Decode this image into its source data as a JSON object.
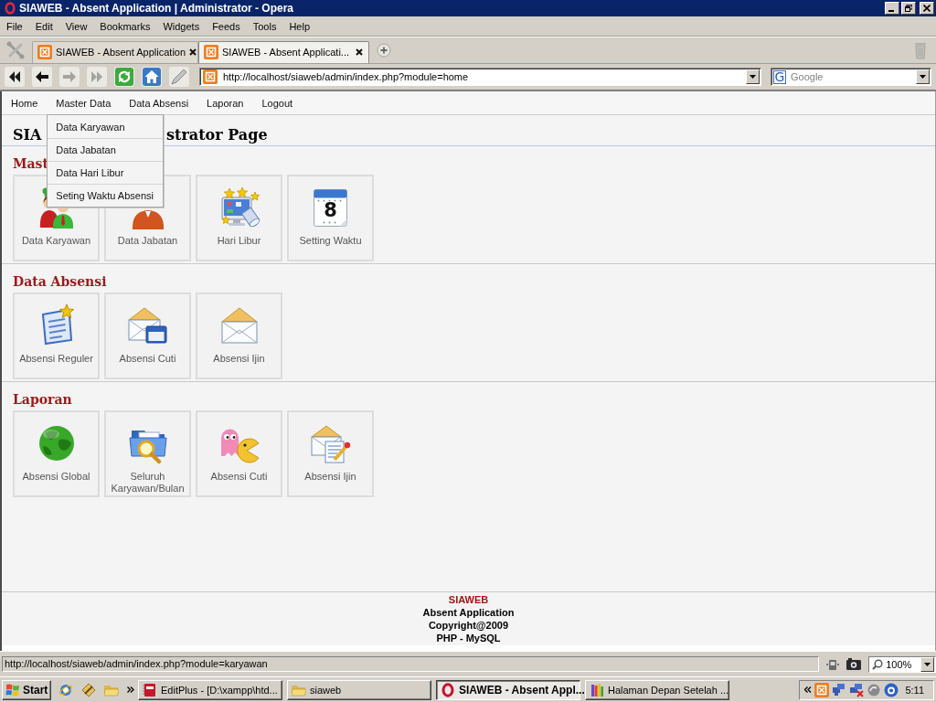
{
  "window": {
    "title": "SIAWEB - Absent Application | Administrator - Opera"
  },
  "menu_bar": [
    "File",
    "Edit",
    "View",
    "Bookmarks",
    "Widgets",
    "Feeds",
    "Tools",
    "Help"
  ],
  "tabs": [
    {
      "label": "SIAWEB - Absent Application",
      "selected": false
    },
    {
      "label": "SIAWEB - Absent Applicati...",
      "selected": true
    }
  ],
  "toolbar": {
    "buttons": [
      {
        "disabled": false
      },
      {
        "disabled": false
      },
      {
        "disabled": true
      },
      {
        "disabled": true
      },
      {
        "disabled": false
      },
      {
        "disabled": false
      },
      {
        "disabled": false
      }
    ],
    "address": "http://localhost/siaweb/admin/index.php?module=home",
    "search": {
      "logo": "G",
      "placeholder": "Google"
    }
  },
  "page": {
    "nav": [
      {
        "label": "Home"
      },
      {
        "label": "Master Data",
        "dropdown": [
          "Data Karyawan",
          "Data Jabatan",
          "Data Hari Libur",
          "Seting Waktu Absensi"
        ]
      },
      {
        "label": "Data Absensi"
      },
      {
        "label": "Laporan"
      },
      {
        "label": "Logout"
      }
    ],
    "heading": [
      "SIA",
      "strator Page"
    ],
    "sections": [
      {
        "title": "Mast",
        "cards": [
          {
            "label": "Data Karyawan"
          },
          {
            "label": "Data Jabatan"
          },
          {
            "label": "Hari Libur"
          },
          {
            "label": "Setting Waktu",
            "icon_text": "8"
          }
        ]
      },
      {
        "title": "Data Absensi",
        "cards": [
          {
            "label": "Absensi Reguler"
          },
          {
            "label": "Absensi Cuti"
          },
          {
            "label": "Absensi Ijin"
          }
        ]
      },
      {
        "title": "Laporan",
        "cards": [
          {
            "label": "Absensi Global"
          },
          {
            "label": "Seluruh Karyawan/Bulan"
          },
          {
            "label": "Absensi Cuti"
          },
          {
            "label": "Absensi Ijin"
          }
        ]
      }
    ],
    "footer": {
      "title": "SIAWEB",
      "lines": [
        "Absent Application",
        "Copyright@2009",
        "PHP - MySQL"
      ]
    }
  },
  "status_bar": {
    "url": "http://localhost/siaweb/admin/index.php?module=karyawan",
    "zoom": "100%"
  },
  "taskbar": {
    "start": "Start",
    "tasks": [
      {
        "label": "EditPlus - [D:\\xampp\\htd...",
        "selected": false
      },
      {
        "label": "siaweb",
        "selected": false
      },
      {
        "label": "SIAWEB - Absent Appl...",
        "selected": true
      },
      {
        "label": "Halaman Depan Setelah ...",
        "selected": false
      }
    ],
    "clock": "5:11"
  }
}
